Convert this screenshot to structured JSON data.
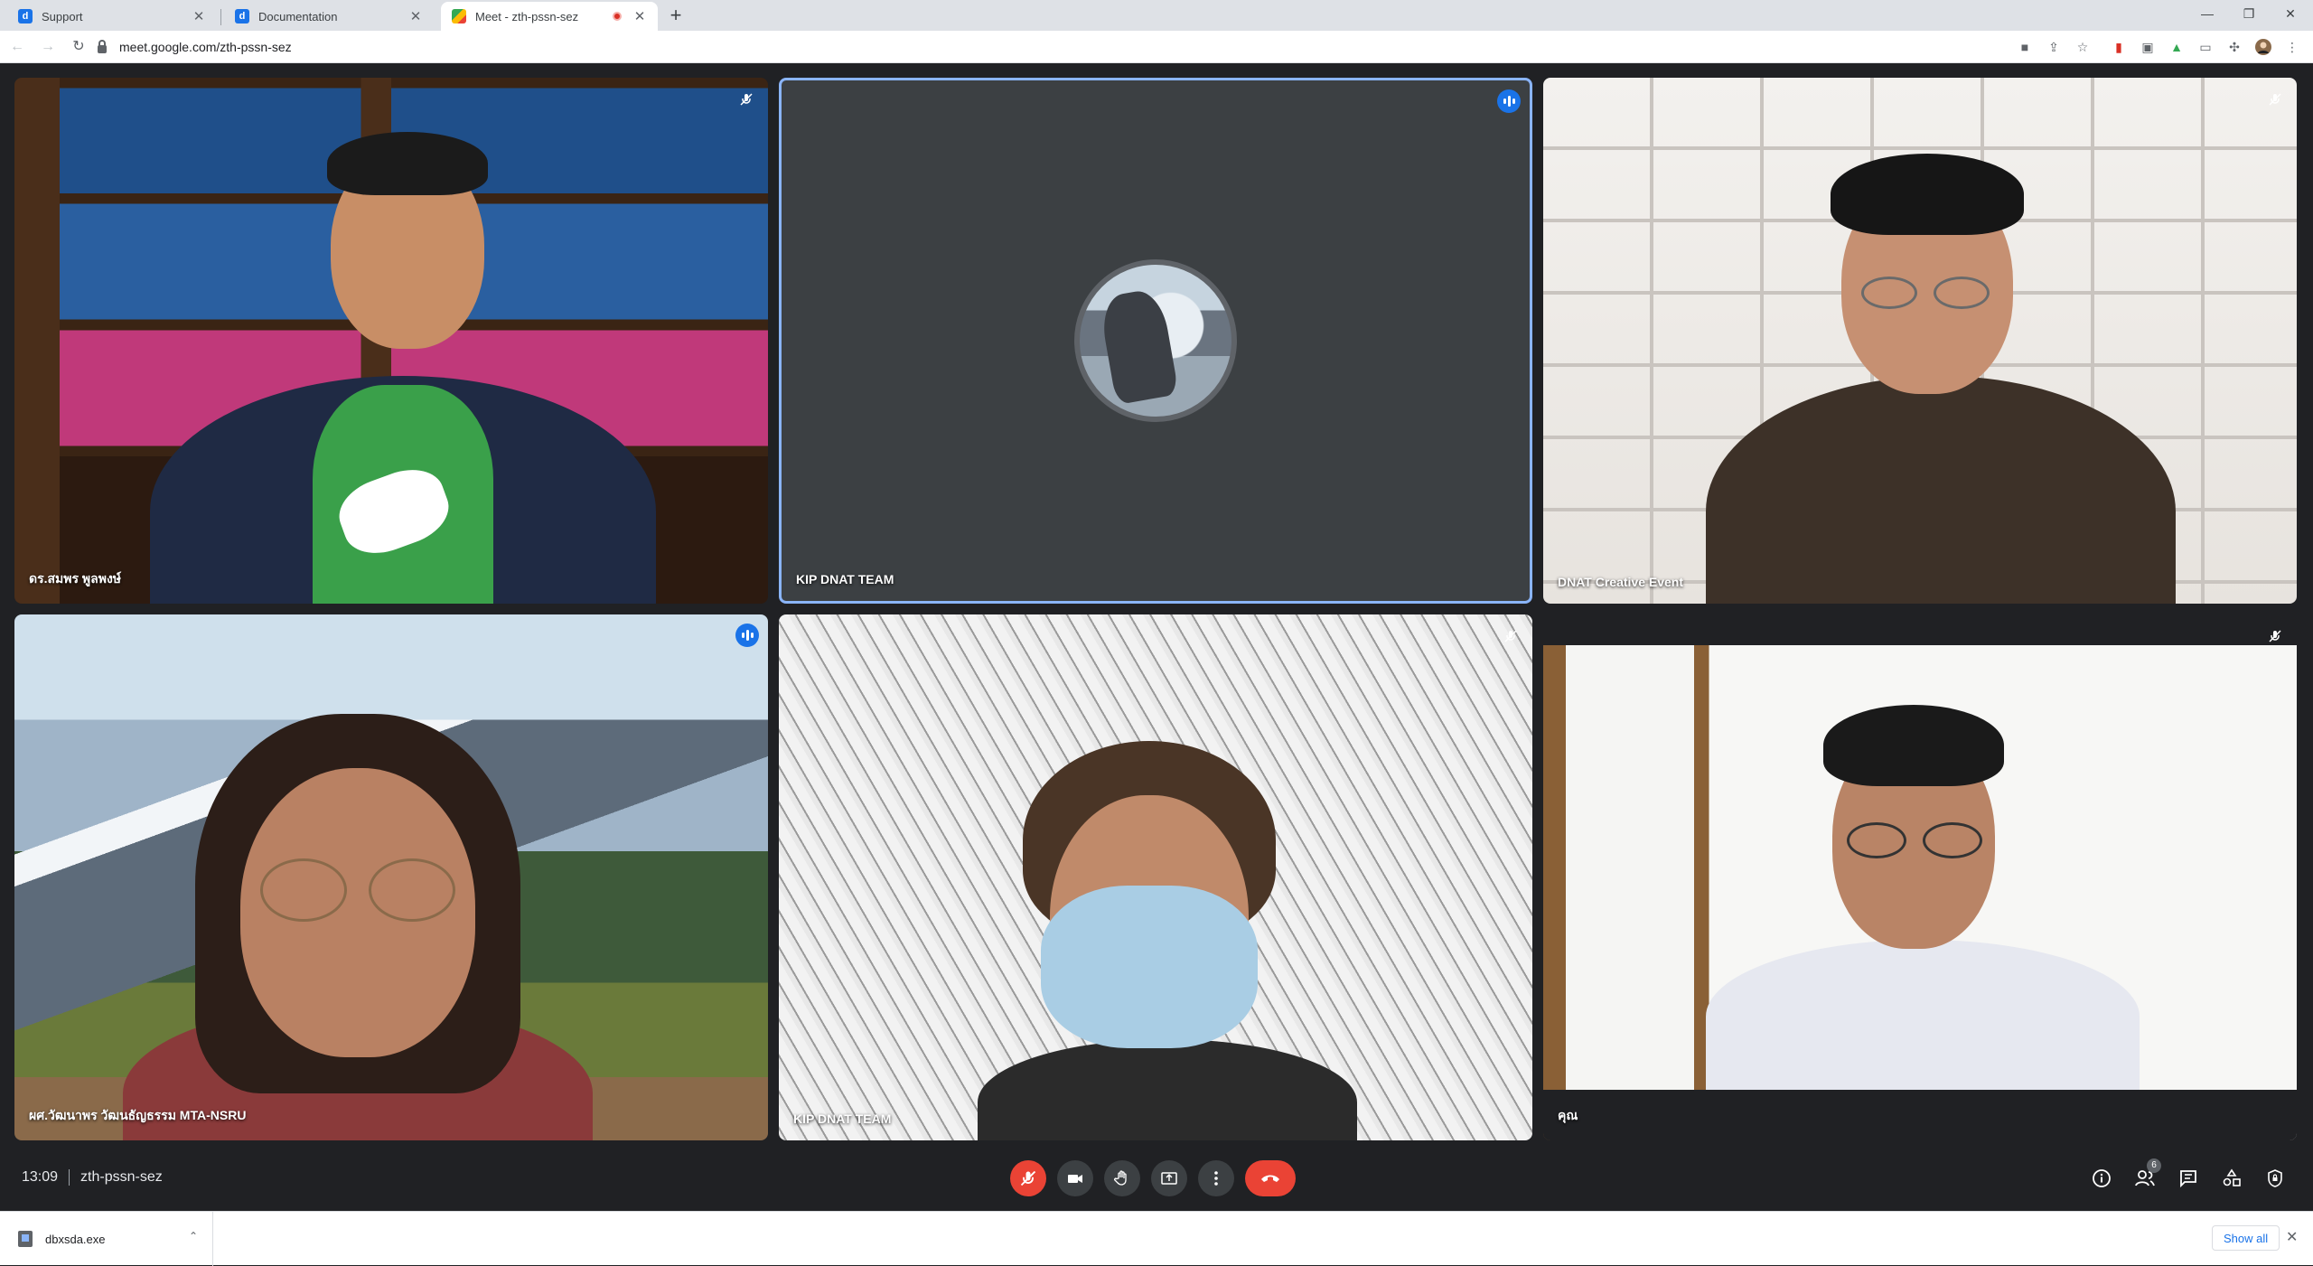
{
  "browser": {
    "tabs": [
      {
        "title": "Support",
        "favicon": "doc-icon"
      },
      {
        "title": "Documentation",
        "favicon": "doc-icon"
      },
      {
        "title": "Meet - zth-pssn-sez",
        "favicon": "meet-icon",
        "recording": true
      }
    ],
    "url": "meet.google.com/zth-pssn-sez",
    "new_tab_glyph": "+",
    "close_glyph": "✕"
  },
  "meeting": {
    "time": "13:09",
    "code": "zth-pssn-sez",
    "participant_count": "6",
    "participants": [
      {
        "name": "ดร.สมพร พูลพงษ์",
        "state": "mic-off"
      },
      {
        "name": "KIP DNAT TEAM",
        "state": "speaking"
      },
      {
        "name": "DNAT Creative Event",
        "state": "mic-off"
      },
      {
        "name": "ผศ.วัฒนาพร วัฒนธัญธรรม MTA-NSRU",
        "state": "speaking"
      },
      {
        "name": "KIP DNAT TEAM",
        "state": "mic-off"
      },
      {
        "name": "คุณ",
        "state": "mic-off"
      }
    ]
  },
  "downloads": {
    "file": "dbxsda.exe",
    "show_all": "Show all"
  },
  "colors": {
    "accent": "#1a73e8",
    "danger": "#ea4335",
    "meet_bg": "#202124"
  }
}
